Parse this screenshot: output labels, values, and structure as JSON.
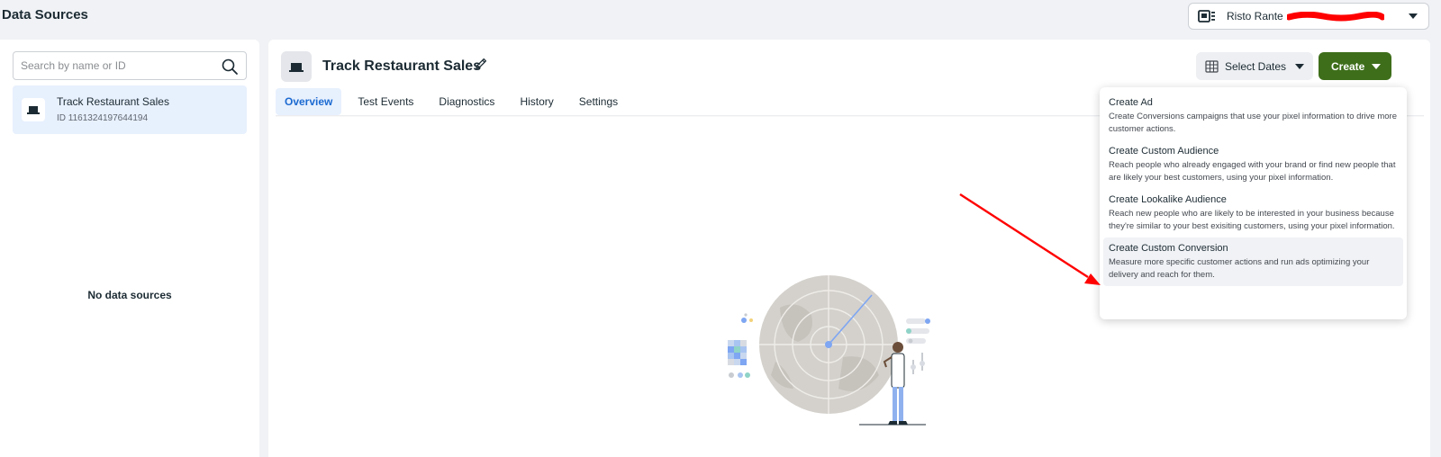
{
  "page": {
    "title": "Data Sources"
  },
  "account": {
    "name": "Risto Rante",
    "redaction_color": "#ff0000"
  },
  "sidebar": {
    "search_placeholder": "Search by name or ID",
    "items": [
      {
        "name": "Track Restaurant Sales",
        "id_label": "ID 1161324197644194"
      }
    ],
    "empty_text": "No data sources"
  },
  "main": {
    "title": "Track Restaurant Sales",
    "select_dates_label": "Select Dates",
    "create_label": "Create",
    "tabs": [
      {
        "label": "Overview",
        "active": true
      },
      {
        "label": "Test Events"
      },
      {
        "label": "Diagnostics"
      },
      {
        "label": "History"
      },
      {
        "label": "Settings"
      }
    ]
  },
  "create_menu": {
    "items": [
      {
        "title": "Create Ad",
        "description": "Create Conversions campaigns that use your pixel information to drive more customer actions."
      },
      {
        "title": "Create Custom Audience",
        "description": "Reach people who already engaged with your brand or find new people that are likely your best customers, using your pixel information."
      },
      {
        "title": "Create Lookalike Audience",
        "description": "Reach new people who are likely to be interested in your business because they're similar to your best exisiting customers, using your pixel information."
      },
      {
        "title": "Create Custom Conversion",
        "description": "Measure more specific customer actions and run ads optimizing your delivery and reach for them."
      }
    ]
  },
  "colors": {
    "accent": "#1b6ad1",
    "create_button": "#3e6e1a",
    "annotation_arrow": "#ff0000"
  }
}
